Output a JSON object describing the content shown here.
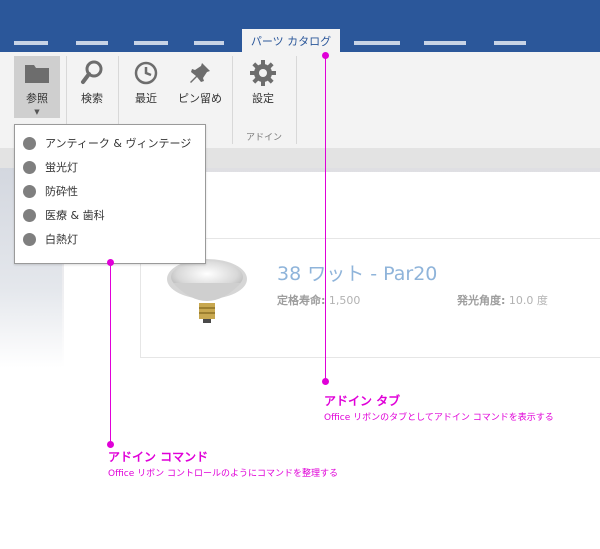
{
  "window": {
    "active_tab": "パーツ カタログ"
  },
  "ribbon": {
    "buttons": [
      {
        "label": "参照",
        "icon": "folder-icon"
      },
      {
        "label": "検索",
        "icon": "search-icon"
      },
      {
        "label": "最近",
        "icon": "clock-icon"
      },
      {
        "label": "ピン留め",
        "icon": "pin-icon"
      },
      {
        "label": "設定",
        "icon": "gear-icon"
      }
    ],
    "group_label": "アドイン"
  },
  "dropdown": {
    "items": [
      "アンティーク & ヴィンテージ",
      "蛍光灯",
      "防砕性",
      "医療 & 歯科",
      "白熱灯"
    ]
  },
  "product": {
    "title": "38 ワット - Par20",
    "life_label": "定格寿命:",
    "life_value": "1,500",
    "angle_label": "発光角度:",
    "angle_value": "10.0 度"
  },
  "callouts": {
    "tab": {
      "title": "アドイン タブ",
      "desc": "Office リボンのタブとしてアドイン コマンドを表示する"
    },
    "command": {
      "title": "アドイン コマンド",
      "desc": "Office リボン コントロールのようにコマンドを整理する"
    }
  },
  "colors": {
    "title_bar": "#2b579a",
    "callout": "#e000d8",
    "accent_text": "#8fb4da"
  }
}
